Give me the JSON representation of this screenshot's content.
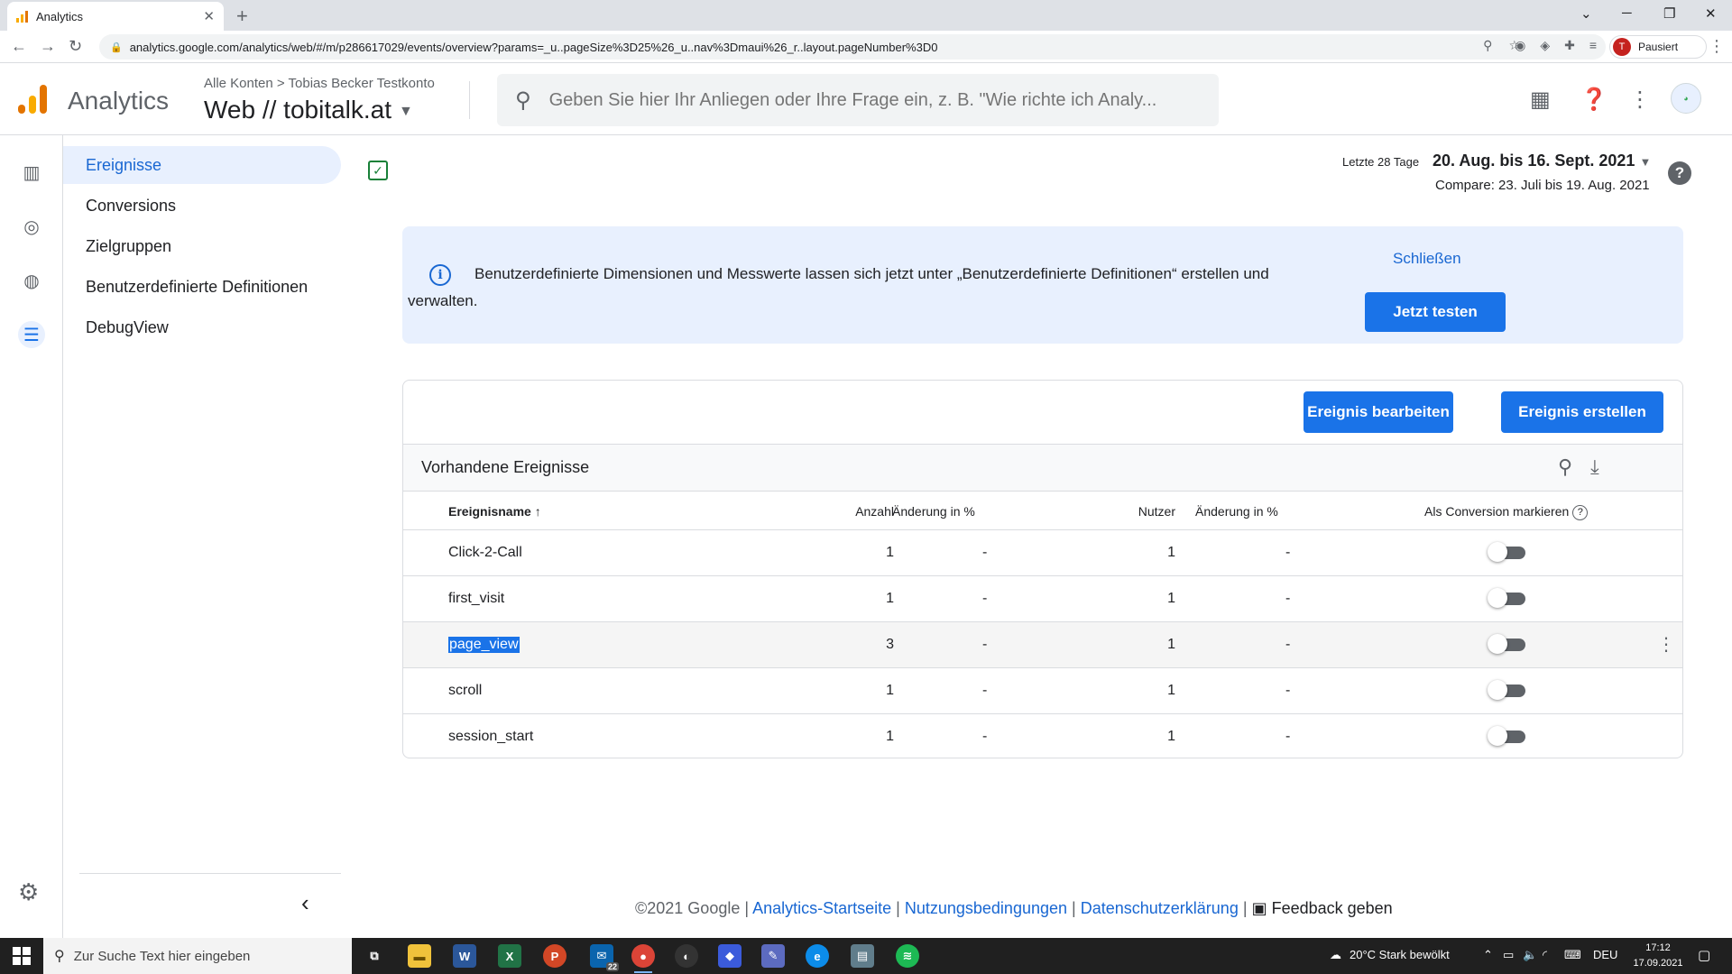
{
  "browser": {
    "tab_title": "Analytics",
    "url": "analytics.google.com/analytics/web/#/m/p286617029/events/overview?params=_u..pageSize%3D25%26_u..nav%3Dmaui%26_r..layout.pageNumber%3D0",
    "profile_initial": "T",
    "profile_label": "Pausiert"
  },
  "header": {
    "app_title": "Analytics",
    "breadcrumb": "Alle Konten > Tobias Becker Testkonto",
    "property": "Web // tobitalk.at",
    "search_placeholder": "Geben Sie hier Ihr Anliegen oder Ihre Frage ein, z. B. \"Wie richte ich Analy..."
  },
  "sidenav": {
    "items": [
      {
        "label": "Ereignisse",
        "active": true
      },
      {
        "label": "Conversions"
      },
      {
        "label": "Zielgruppen"
      },
      {
        "label": "Benutzerdefinierte Definitionen"
      },
      {
        "label": "DebugView"
      }
    ]
  },
  "date": {
    "label": "Letzte 28 Tage",
    "range": "20. Aug. bis 16. Sept. 2021",
    "compare": "Compare: 23. Juli bis 19. Aug. 2021"
  },
  "banner": {
    "message": "Benutzerdefinierte Dimensionen und Messwerte lassen sich jetzt unter „Benutzerdefinierte Definitionen“ erstellen und verwalten.",
    "close_label": "Schließen",
    "cta_label": "Jetzt testen"
  },
  "events": {
    "edit_label": "Ereignis bearbeiten",
    "create_label": "Ereignis erstellen",
    "title": "Vorhandene Ereignisse",
    "columns": {
      "name": "Ereignisname",
      "count": "Anzahl",
      "change1": "Änderung in %",
      "users": "Nutzer",
      "change2": "Änderung in %",
      "conversion": "Als Conversion markieren"
    },
    "rows": [
      {
        "name": "Click-2-Call",
        "count": "1",
        "change1": "-",
        "users": "1",
        "change2": "-",
        "conversion": false
      },
      {
        "name": "first_visit",
        "count": "1",
        "change1": "-",
        "users": "1",
        "change2": "-",
        "conversion": false
      },
      {
        "name": "page_view",
        "count": "3",
        "change1": "-",
        "users": "1",
        "change2": "-",
        "conversion": false
      },
      {
        "name": "scroll",
        "count": "1",
        "change1": "-",
        "users": "1",
        "change2": "-",
        "conversion": false
      },
      {
        "name": "session_start",
        "count": "1",
        "change1": "-",
        "users": "1",
        "change2": "-",
        "conversion": false
      }
    ]
  },
  "footer": {
    "copyright": "©2021 Google",
    "separator": "|",
    "link_home": "Analytics-Startseite",
    "link_terms": "Nutzungsbedingungen",
    "link_privacy": "Datenschutzerklärung",
    "feedback": "Feedback geben"
  },
  "taskbar": {
    "search_placeholder": "Zur Suche Text hier eingeben",
    "mail_badge": "22",
    "weather": "20°C  Stark bewölkt",
    "language": "DEU",
    "time": "17:12",
    "date": "17.09.2021"
  },
  "colors": {
    "accent": "#1a73e8",
    "nav_active_bg": "#e8f0fe",
    "banner_bg": "#e8f0fe"
  }
}
